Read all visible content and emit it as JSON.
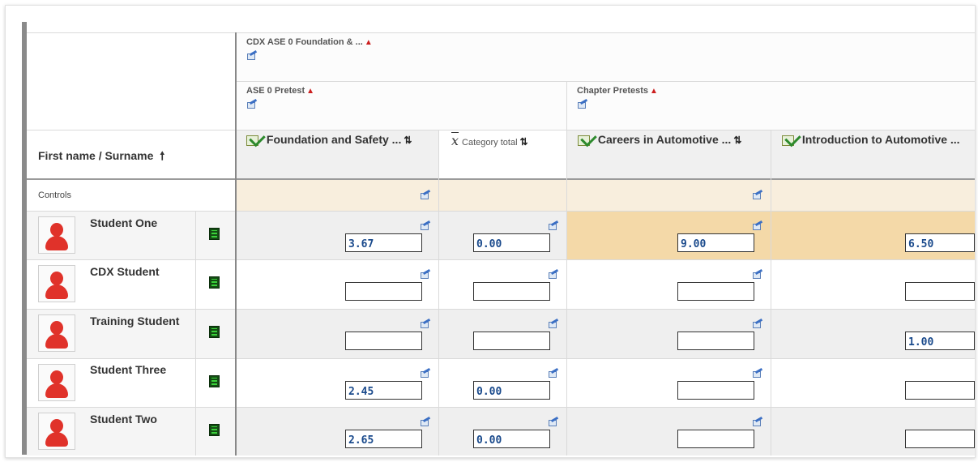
{
  "header": {
    "top_category": "CDX ASE 0 Foundation & ...",
    "sub_category_1": "ASE 0 Pretest",
    "sub_category_2": "Chapter Pretests",
    "name_header": "First name / Surname"
  },
  "columns": [
    {
      "label": "Foundation and Safety ..."
    },
    {
      "label": "Category total"
    },
    {
      "label": "Careers in Automotive ..."
    },
    {
      "label": "Introduction to Automotive ..."
    }
  ],
  "controls_label": "Controls",
  "students": [
    {
      "name": "Student One",
      "grades": [
        "3.67",
        "0.00",
        "9.00",
        "6.50"
      ]
    },
    {
      "name": "CDX Student",
      "grades": [
        "",
        "",
        "",
        ""
      ]
    },
    {
      "name": "Training Student",
      "grades": [
        "",
        "",
        "",
        "1.00"
      ]
    },
    {
      "name": "Student Three",
      "grades": [
        "2.45",
        "0.00",
        "",
        ""
      ]
    },
    {
      "name": "Student Two",
      "grades": [
        "2.65",
        "0.00",
        "",
        ""
      ]
    }
  ],
  "icons": {
    "calculation": "calculator-edit-icon",
    "grade_item": "grade-item-icon",
    "avatar": "user-avatar-icon",
    "single_view": "single-view-icon",
    "mean": "mean-xbar-icon"
  },
  "colors": {
    "header_bg": "#f9f9f9",
    "controls_bg": "#f8eedd",
    "highlight_bg": "#f4d9a8",
    "alt_row_bg": "#efefef",
    "value_text": "#1a4a8c",
    "sort_up": "#cc1f1f"
  }
}
